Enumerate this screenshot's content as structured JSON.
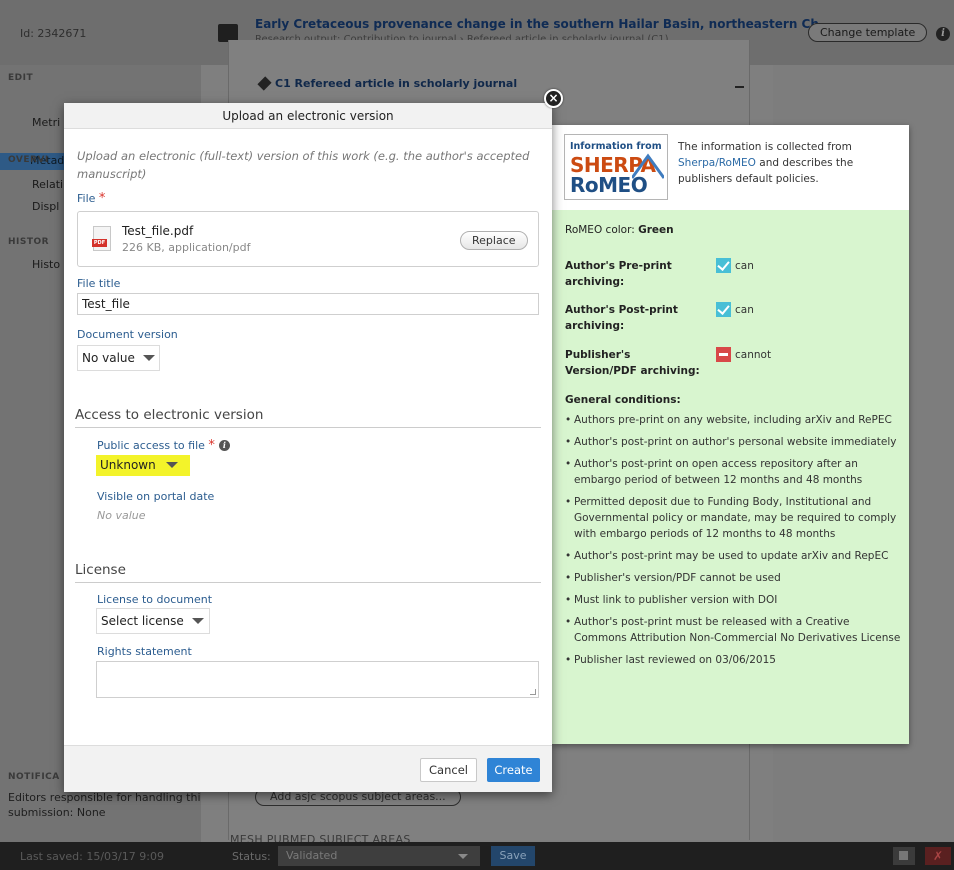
{
  "app": {
    "id_label": "Id: 2342671",
    "title": "Early Cretaceous provenance change in the southern Hailar Basin, northeastern Ch",
    "subtitle": "Research output: Contribution to journal › Refereed article in scholarly journal (C1)",
    "change_template": "Change template"
  },
  "sidebar": {
    "edit_heading": "EDIT",
    "metadata": "Metadata",
    "metrics": "Metri",
    "overview_heading": "OVERVI",
    "relations": "Relati",
    "display": "Displ",
    "history_heading": "HISTOR",
    "history": "Histo",
    "notifications_heading": "NOTIFICA",
    "notifications_text": "Editors responsible for handling this submission: None"
  },
  "background": {
    "c1_label": "C1 Refereed article in scholarly journal",
    "asjc_button": "Add asjc scopus subject areas...",
    "mesh_heading": "MESH PUBMED SUBJECT AREAS"
  },
  "footer": {
    "last_saved": "Last saved: 15/03/17 9:09",
    "status_label": "Status:",
    "status_value": "Validated",
    "save": "Save"
  },
  "modal": {
    "title": "Upload an electronic version",
    "intro": "Upload an electronic (full-text) version of this work (e.g. the author's accepted manuscript)",
    "file_label": "File",
    "file_name": "Test_file.pdf",
    "file_meta": "226 KB, application/pdf",
    "replace": "Replace",
    "file_title_label": "File title",
    "file_title_value": "Test_file",
    "doc_version_label": "Document version",
    "doc_version_value": "No value",
    "access_section": "Access to electronic version",
    "public_access_label": "Public access to file",
    "public_access_value": "Unknown",
    "visible_date_label": "Visible on portal date",
    "visible_date_value": "No value",
    "license_section": "License",
    "license_label": "License to document",
    "license_value": "Select license",
    "rights_label": "Rights statement",
    "cancel": "Cancel",
    "create": "Create",
    "highlight_color": "#f3f32a",
    "create_color": "#2f84d6"
  },
  "sherpa": {
    "logo_line1": "Information from",
    "logo_line2": "SHERPA",
    "logo_line3": "RoMEO",
    "info_prefix": "The information is collected from",
    "info_link": "Sherpa/RoMEO",
    "info_suffix": "and describes the publishers default policies.",
    "color_label": "RoMEO color:",
    "color_value": "Green",
    "pre_print_label": "Author's Pre-print archiving:",
    "pre_print_value": "can",
    "post_print_label": "Author's Post-print archiving:",
    "post_print_value": "can",
    "publisher_label": "Publisher's Version/PDF archiving:",
    "publisher_value": "cannot",
    "conditions_title": "General conditions:",
    "conditions": [
      "Authors pre-print on any website, including arXiv and RePEC",
      "Author's post-print on author's personal website immediately",
      "Author's post-print on open access repository after an embargo period of between 12 months and 48 months",
      "Permitted deposit due to Funding Body, Institutional and Governmental policy or mandate, may be required to comply with embargo periods of 12 months to 48 months",
      "Author's post-print may be used to update arXiv and RepEC",
      "Publisher's version/PDF cannot be used",
      "Must link to publisher version with DOI",
      "Author's post-print must be released with a Creative Commons Attribution Non-Commercial No Derivatives License",
      "Publisher last reviewed on 03/06/2015"
    ],
    "panel_color": "#d8f5cf"
  }
}
